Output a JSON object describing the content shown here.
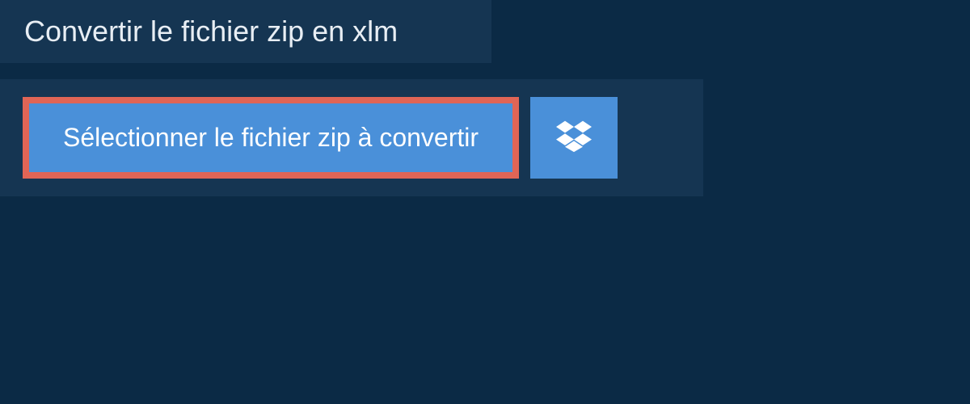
{
  "header": {
    "title": "Convertir le fichier zip en xlm"
  },
  "upload": {
    "select_label": "Sélectionner le fichier zip à convertir"
  }
}
